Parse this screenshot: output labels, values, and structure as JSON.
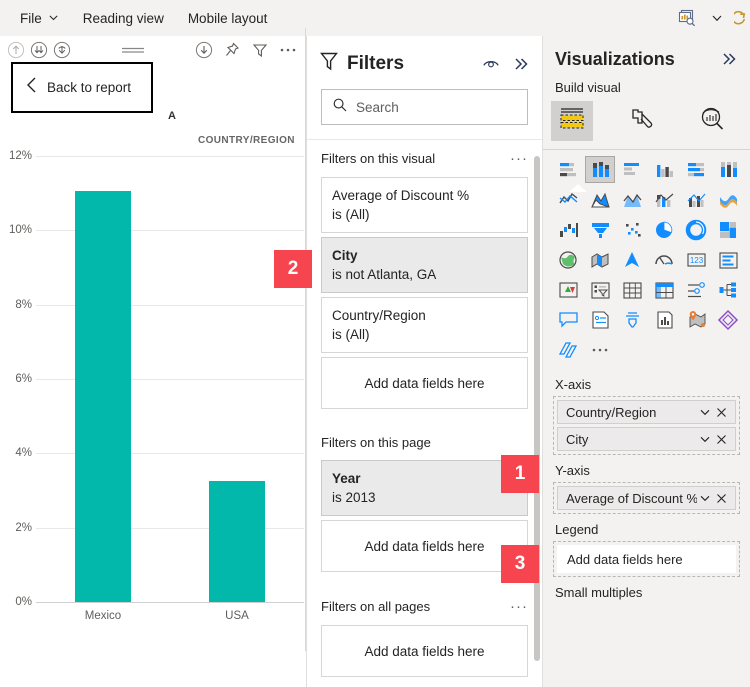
{
  "menubar": {
    "items": [
      {
        "label": "File",
        "icon": "chevron-down-icon",
        "has_chevron": true
      },
      {
        "label": "Reading view",
        "has_chevron": false
      },
      {
        "label": "Mobile layout",
        "has_chevron": false
      }
    ],
    "right_icons": [
      "visual-search-icon",
      "chevron-down-icon",
      "refresh-icon"
    ]
  },
  "canvas": {
    "toolbar_icons": [
      "drill-up-icon",
      "drill-down-all-icon",
      "drill-down-icon",
      "drag-handle-icon",
      "export-icon",
      "pin-icon",
      "filter-icon",
      "more-options-icon"
    ],
    "visual_title": "A",
    "visual_subtitle": "COUNTRY/REGION",
    "back_to_report": {
      "label": "Back to report",
      "icon": "chevron-left-icon"
    }
  },
  "chart_data": {
    "type": "bar",
    "title": "Average of Discount % by Country/Region",
    "xlabel": "COUNTRY/REGION",
    "ylabel": "",
    "categories": [
      "Mexico",
      "USA"
    ],
    "values": [
      11.05,
      3.25
    ],
    "value_format": "percent",
    "ylim": [
      0,
      12
    ],
    "yticks": [
      0,
      2,
      4,
      6,
      8,
      10,
      12
    ],
    "ytick_labels": [
      "0%",
      "2%",
      "4%",
      "6%",
      "8%",
      "10%",
      "12%"
    ],
    "grid": true,
    "legend": "none",
    "series_color": "#01b8aa"
  },
  "filters_pane": {
    "title": "Filters",
    "funnel_icon": "filter-funnel-icon",
    "eye_icon": "eye-icon",
    "collapse_icon": "double-chevron-right-icon",
    "search": {
      "placeholder": "Search",
      "value": "",
      "icon": "search-icon"
    },
    "sections": [
      {
        "title": "Filters on this visual",
        "menu": "···",
        "cards": [
          {
            "name": "Average of Discount %",
            "value": "is (All)",
            "active": false,
            "bold": false
          },
          {
            "name": "City",
            "value": "is not Atlanta, GA",
            "active": true,
            "bold": true
          },
          {
            "name": "Country/Region",
            "value": "is (All)",
            "active": false,
            "bold": false
          }
        ],
        "dropzone": "Add data fields here"
      },
      {
        "title": "Filters on this page",
        "menu": "",
        "cards": [
          {
            "name": "Year",
            "value": "is 2013",
            "active": true,
            "bold": true
          }
        ],
        "dropzone": "Add data fields here"
      },
      {
        "title": "Filters on all pages",
        "menu": "···",
        "cards": [],
        "dropzone": "Add data fields here"
      }
    ]
  },
  "visualizations_pane": {
    "title": "Visualizations",
    "collapse_icon": "double-chevron-right-icon",
    "build_visual_label": "Build visual",
    "tabs": [
      {
        "name": "build-visual-tab",
        "icon": "fields-icon",
        "selected": true
      },
      {
        "name": "format-visual-tab",
        "icon": "paint-roller-icon",
        "selected": false
      },
      {
        "name": "analytics-tab",
        "icon": "magnifier-chart-icon",
        "selected": false
      }
    ],
    "gallery": [
      {
        "icon": "stacked-bar-chart-icon",
        "selected": false
      },
      {
        "icon": "stacked-column-chart-icon",
        "selected": true
      },
      {
        "icon": "clustered-bar-chart-icon",
        "selected": false
      },
      {
        "icon": "clustered-column-chart-icon",
        "selected": false
      },
      {
        "icon": "100-stacked-bar-chart-icon",
        "selected": false
      },
      {
        "icon": "100-stacked-column-chart-icon",
        "selected": false
      },
      {
        "icon": "line-chart-icon",
        "selected": false
      },
      {
        "icon": "area-chart-icon",
        "selected": false
      },
      {
        "icon": "stacked-area-chart-icon",
        "selected": false
      },
      {
        "icon": "line-stacked-column-chart-icon",
        "selected": false
      },
      {
        "icon": "line-clustered-column-chart-icon",
        "selected": false
      },
      {
        "icon": "ribbon-chart-icon",
        "selected": false
      },
      {
        "icon": "waterfall-chart-icon",
        "selected": false
      },
      {
        "icon": "funnel-chart-icon",
        "selected": false
      },
      {
        "icon": "scatter-chart-icon",
        "selected": false
      },
      {
        "icon": "pie-chart-icon",
        "selected": false
      },
      {
        "icon": "donut-chart-icon",
        "selected": false
      },
      {
        "icon": "treemap-icon",
        "selected": false
      },
      {
        "icon": "map-icon",
        "selected": false
      },
      {
        "icon": "filled-map-icon",
        "selected": false
      },
      {
        "icon": "azure-map-icon",
        "selected": false
      },
      {
        "icon": "gauge-icon",
        "selected": false
      },
      {
        "icon": "card-icon",
        "selected": false
      },
      {
        "icon": "multi-row-card-icon",
        "selected": false
      },
      {
        "icon": "kpi-icon",
        "selected": false
      },
      {
        "icon": "slicer-icon",
        "selected": false
      },
      {
        "icon": "table-icon",
        "selected": false
      },
      {
        "icon": "matrix-icon",
        "selected": false
      },
      {
        "icon": "r-script-visual-icon",
        "selected": false
      },
      {
        "icon": "decomposition-tree-icon",
        "selected": false
      },
      {
        "icon": "key-influencers-icon",
        "selected": false
      },
      {
        "icon": "narrative-icon",
        "selected": false
      },
      {
        "icon": "paginated-report-icon",
        "selected": false
      },
      {
        "icon": "python-visual-icon",
        "selected": false
      },
      {
        "icon": "arcgis-map-icon",
        "selected": false
      },
      {
        "icon": "powerapps-icon",
        "selected": false
      },
      {
        "icon": "power-automate-icon",
        "selected": false
      },
      {
        "icon": "more-visuals-icon",
        "selected": false
      }
    ],
    "wells": [
      {
        "label": "X-axis",
        "chips": [
          {
            "label": "Country/Region",
            "chevron": "chevron-down-icon",
            "remove": "close-icon"
          },
          {
            "label": "City",
            "chevron": "chevron-down-icon",
            "remove": "close-icon"
          }
        ],
        "empty": null
      },
      {
        "label": "Y-axis",
        "chips": [
          {
            "label": "Average of Discount %",
            "chevron": "chevron-down-icon",
            "remove": "close-icon"
          }
        ],
        "empty": null
      },
      {
        "label": "Legend",
        "chips": [],
        "empty": "Add data fields here"
      }
    ],
    "small_multiples_label": "Small multiples"
  },
  "badges": [
    {
      "number": "1",
      "target": "filters-on-this-page-section"
    },
    {
      "number": "2",
      "target": "city-filter-card"
    },
    {
      "number": "3",
      "target": "page-filter-dropzone"
    }
  ],
  "colors": {
    "bar": "#01b8aa",
    "badge": "#f74550",
    "pane_bg": "#f3f2f1",
    "accent_blue": "#118dff"
  }
}
